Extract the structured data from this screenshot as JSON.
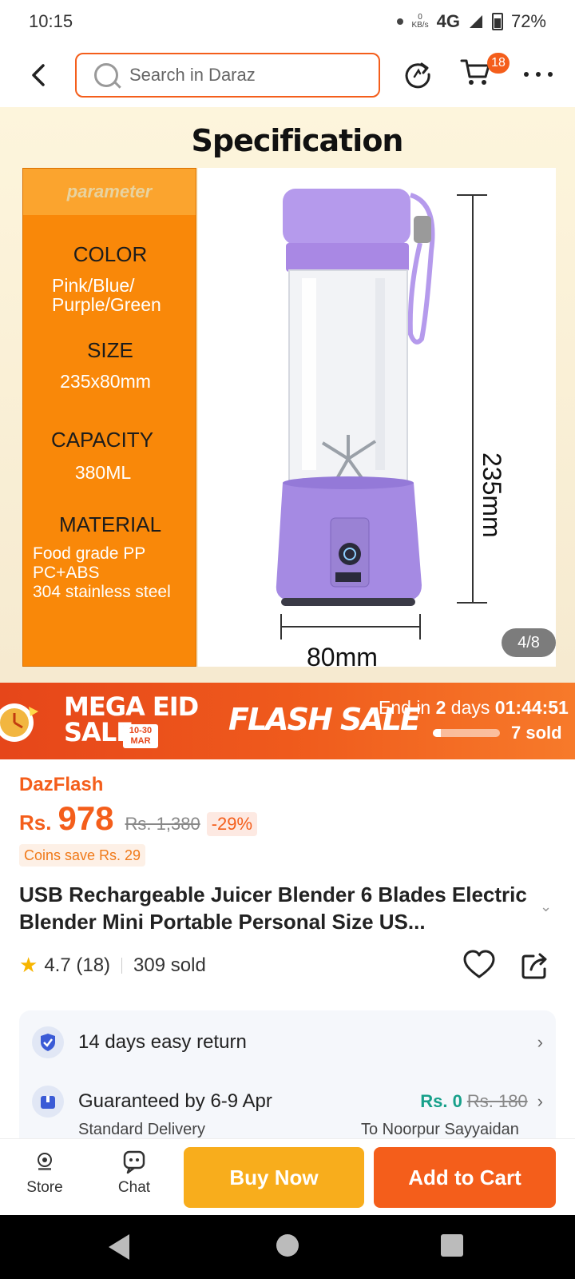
{
  "status_bar": {
    "time": "10:15",
    "speed_value": "0",
    "speed_unit": "KB/s",
    "network": "4G",
    "battery": "72%"
  },
  "search": {
    "placeholder": "Search in Daraz"
  },
  "header": {
    "cart_count": "18"
  },
  "product_image": {
    "heading": "Specification",
    "param_header": "parameter",
    "specs": [
      {
        "label": "COLOR",
        "value": "Pink/Blue/\nPurple/Green"
      },
      {
        "label": "SIZE",
        "value": "235x80mm"
      },
      {
        "label": "CAPACITY",
        "value": "380ML"
      },
      {
        "label": "MATERIAL",
        "value": "Food grade PP\nPC+ABS\n304 stainless steel"
      }
    ],
    "height_dim": "235mm",
    "width_dim": "80mm",
    "counter": "4/8",
    "product_color": "#b08ee6"
  },
  "flash_banner": {
    "mega_line1": "MEGA EID",
    "mega_line2": "SALE",
    "mega_dates": "10-30",
    "mega_month": "MAR",
    "flash_label": "FLASH SALE",
    "ends_prefix": "End in",
    "days": "2",
    "days_word": "days",
    "time_left": "01:44:51",
    "sold_text": "7 sold",
    "sold_fraction": 0.12
  },
  "price": {
    "store": "DazFlash",
    "currency": "Rs.",
    "current": "978",
    "original": "Rs. 1,380",
    "discount": "-29%",
    "coins": "Coins save Rs. 29"
  },
  "product": {
    "title": "USB Rechargeable Juicer Blender 6 Blades Electric Blender Mini Portable Personal Size US...",
    "rating": "4.7",
    "rating_count": "(18)",
    "sold": "309 sold"
  },
  "services": {
    "return_text": "14 days easy return",
    "delivery_text": "Guaranteed by 6-9 Apr",
    "delivery_price": "Rs. 0",
    "delivery_old_price": "Rs. 180",
    "delivery_type": "Standard Delivery",
    "delivery_location": "To Noorpur Sayyaidan"
  },
  "bottom_bar": {
    "store_label": "Store",
    "chat_label": "Chat",
    "buy_label": "Buy Now",
    "cart_label": "Add to Cart"
  },
  "colors": {
    "accent": "#f45e1b",
    "buy": "#f8ad1c",
    "spec_orange": "#f98809",
    "free_green": "#17a08a"
  }
}
